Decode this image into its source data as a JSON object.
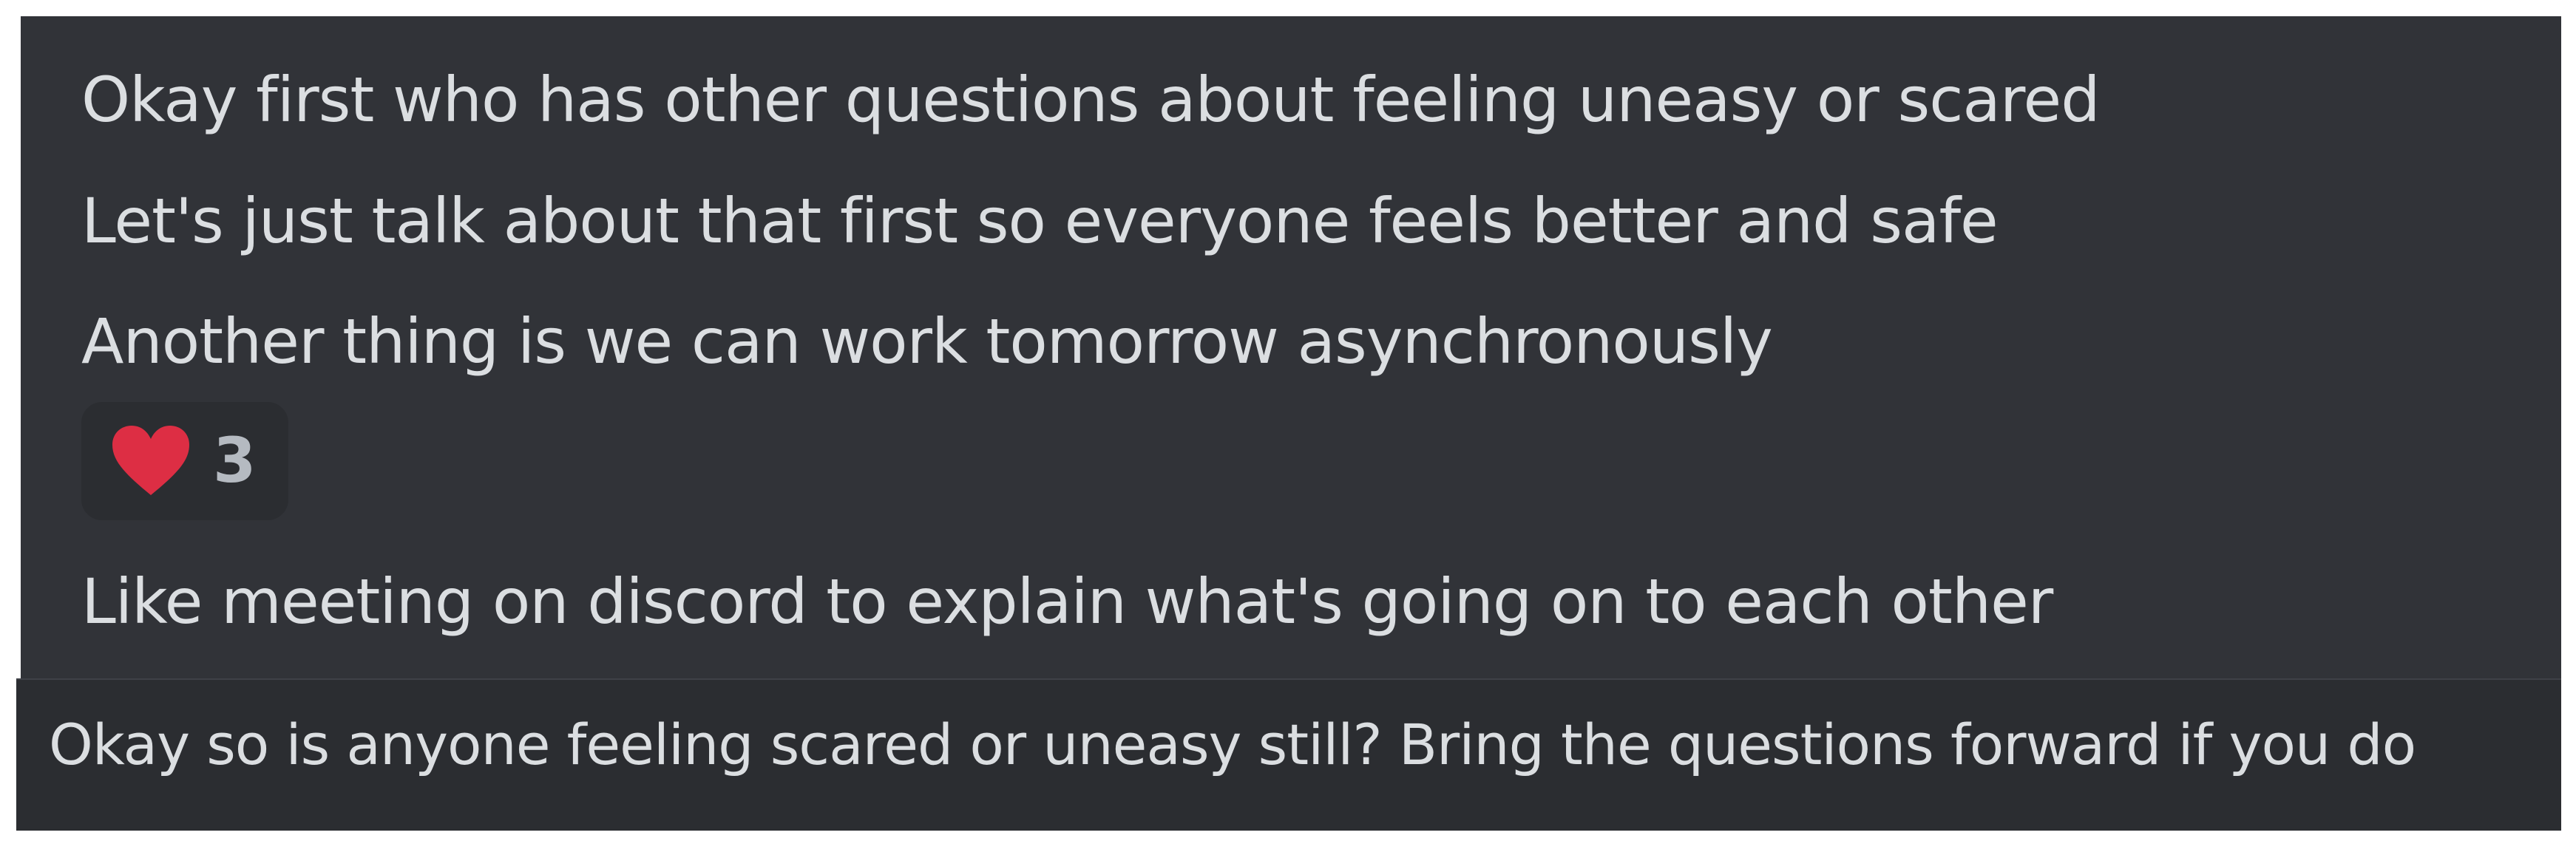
{
  "messages": [
    "Okay first who has other questions about feeling uneasy or scared",
    "Let's just talk about that first so everyone feels better and safe",
    "Another thing is we can work tomorrow asynchronously",
    "Like meeting on discord to explain what's going on to each other"
  ],
  "reaction": {
    "icon": "heart-icon",
    "count": "3",
    "color": "#dd2e44"
  },
  "composer": {
    "text": "Okay so is anyone feeling scared or uneasy still? Bring the questions forward if you do"
  },
  "colors": {
    "chat_background": "#313338",
    "composer_background": "#2b2d31",
    "text": "#dbdee1"
  }
}
